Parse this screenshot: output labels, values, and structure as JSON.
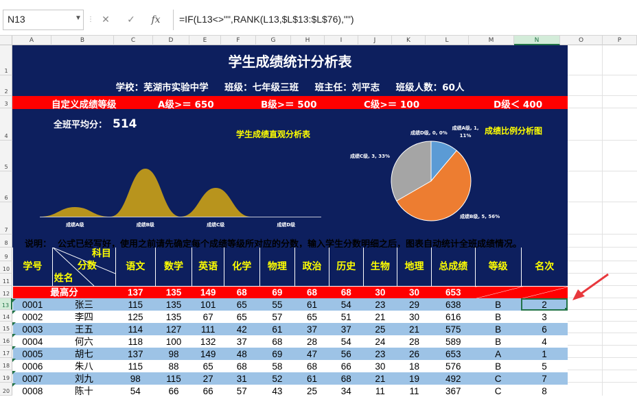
{
  "formula_bar": {
    "name_box": "N13",
    "cancel_icon": "✕",
    "confirm_icon": "✓",
    "fx_label": "fx",
    "formula": "=IF(L13<>\"\",RANK(L13,$L$13:$L$76),\"\")"
  },
  "columns": [
    "A",
    "B",
    "C",
    "D",
    "E",
    "F",
    "G",
    "H",
    "I",
    "J",
    "K",
    "L",
    "M",
    "N",
    "O",
    "P"
  ],
  "rows": [
    "1",
    "2",
    "3",
    "4",
    "5",
    "6",
    "7",
    "8",
    "9",
    "10",
    "11",
    "12",
    "13",
    "14",
    "15",
    "16",
    "17",
    "18",
    "19",
    "20"
  ],
  "header": {
    "title": "学生成绩统计分析表",
    "info": "学校：芜湖市实验中学     班级：七年级三班     班主任：刘平志     班级人数：60人"
  },
  "grades": {
    "label": "自定义成绩等级",
    "a": "A级>＝ 650",
    "b": "B级>＝ 500",
    "c": "C级>＝ 100",
    "d": "D级＜ 400"
  },
  "avg": {
    "label": "全班平均分：",
    "value": "514"
  },
  "area_chart": {
    "title": "学生成绩直观分析表",
    "categories": [
      "成绩A级",
      "成绩B级",
      "成绩C级",
      "成绩D级"
    ]
  },
  "pie_chart": {
    "title": "成绩比例分析图",
    "labels": {
      "a": "成绩A级, 1, 11%",
      "b": "成绩B级, 5, 56%",
      "c": "成绩C级, 3, 33%",
      "d": "成绩D级, 0, 0%"
    }
  },
  "chart_data": [
    {
      "type": "area",
      "title": "学生成绩直观分析表",
      "categories": [
        "成绩A级",
        "成绩B级",
        "成绩C级",
        "成绩D级"
      ],
      "values": [
        1,
        5,
        3,
        0
      ]
    },
    {
      "type": "pie",
      "title": "成绩比例分析图",
      "categories": [
        "成绩A级",
        "成绩B级",
        "成绩C级",
        "成绩D级"
      ],
      "values": [
        1,
        5,
        3,
        0
      ],
      "percents": [
        11,
        56,
        33,
        0
      ],
      "colors": [
        "#5b9bd5",
        "#ed7d31",
        "#a5a5a5",
        "#ffc000"
      ]
    }
  ],
  "note": "说明：  公式已经写好，使用之前请先确定每个成绩等级所对应的分数，输入学生分数明细之后，图表自动统计全班成绩情况。",
  "table": {
    "headers": {
      "id": "学号",
      "subject_top": "科目",
      "subject_score": "分数",
      "name": "姓名",
      "chinese": "语文",
      "math": "数学",
      "english": "英语",
      "chemistry": "化学",
      "physics": "物理",
      "politics": "政治",
      "history": "历史",
      "biology": "生物",
      "geography": "地理",
      "total": "总成绩",
      "grade": "等级",
      "rank": "名次"
    },
    "max_row": {
      "label": "最高分",
      "values": [
        "137",
        "135",
        "149",
        "68",
        "69",
        "68",
        "68",
        "30",
        "30",
        "653"
      ]
    },
    "students": [
      {
        "id": "0001",
        "name": "张三",
        "scores": [
          "115",
          "135",
          "101",
          "65",
          "55",
          "61",
          "54",
          "23",
          "29",
          "638"
        ],
        "grade": "B",
        "rank": "2"
      },
      {
        "id": "0002",
        "name": "李四",
        "scores": [
          "125",
          "135",
          "67",
          "65",
          "57",
          "65",
          "51",
          "21",
          "30",
          "616"
        ],
        "grade": "B",
        "rank": "3"
      },
      {
        "id": "0003",
        "name": "王五",
        "scores": [
          "114",
          "127",
          "111",
          "42",
          "61",
          "37",
          "37",
          "25",
          "21",
          "575"
        ],
        "grade": "B",
        "rank": "6"
      },
      {
        "id": "0004",
        "name": "何六",
        "scores": [
          "118",
          "100",
          "132",
          "37",
          "68",
          "28",
          "54",
          "24",
          "28",
          "589"
        ],
        "grade": "B",
        "rank": "4"
      },
      {
        "id": "0005",
        "name": "胡七",
        "scores": [
          "137",
          "98",
          "149",
          "48",
          "69",
          "47",
          "56",
          "23",
          "26",
          "653"
        ],
        "grade": "A",
        "rank": "1"
      },
      {
        "id": "0006",
        "name": "朱八",
        "scores": [
          "115",
          "88",
          "65",
          "68",
          "58",
          "68",
          "66",
          "30",
          "18",
          "576"
        ],
        "grade": "B",
        "rank": "5"
      },
      {
        "id": "0007",
        "name": "刘九",
        "scores": [
          "98",
          "115",
          "27",
          "31",
          "52",
          "61",
          "68",
          "21",
          "19",
          "492"
        ],
        "grade": "C",
        "rank": "7"
      },
      {
        "id": "0008",
        "name": "陈十",
        "scores": [
          "54",
          "66",
          "66",
          "57",
          "43",
          "25",
          "34",
          "11",
          "11",
          "367"
        ],
        "grade": "C",
        "rank": "8"
      }
    ]
  }
}
